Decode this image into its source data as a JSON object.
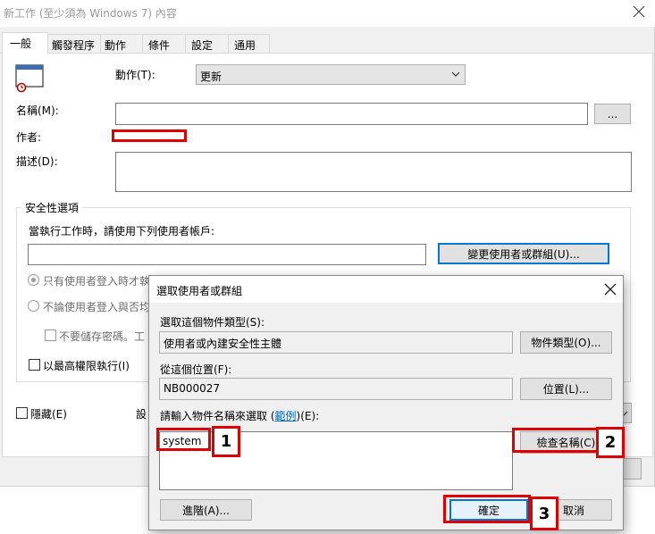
{
  "main_window": {
    "title": "新工作 (至少須為 Windows 7) 內容",
    "tabs": [
      {
        "label": "一般"
      },
      {
        "label": "觸發程序"
      },
      {
        "label": "動作"
      },
      {
        "label": "條件"
      },
      {
        "label": "設定"
      },
      {
        "label": "通用"
      }
    ],
    "action_label": "動作(T):",
    "action_value": "更新",
    "name_label": "名稱(M):",
    "name_value": "",
    "browse_label": "...",
    "author_label": "作者:",
    "description_label": "描述(D):",
    "security_legend": "安全性選項",
    "run_as_text": "當執行工作時，請使用下列使用者帳戶:",
    "change_user_button": "變更使用者或群組(U)...",
    "radio_logged_on": "只有使用者登入時才執",
    "radio_any": "不論使用者登入與否均",
    "no_store_password": "不要儲存密碼。工",
    "highest_privileges": "以最高權限執行(I)",
    "hidden_label": "隱藏(E)",
    "config_label": "設"
  },
  "dialog": {
    "title": "選取使用者或群組",
    "object_type_label": "選取這個物件類型(S):",
    "object_type_value": "使用者或內建安全性主體",
    "object_type_button": "物件類型(O)...",
    "location_label": "從這個位置(F):",
    "location_value": "NB000027",
    "location_button": "位置(L)...",
    "enter_label_pre": "請輸入物件名稱來選取 (",
    "enter_label_link": "範例",
    "enter_label_post": ")(E):",
    "object_name_value": "system",
    "check_names_button": "檢查名稱(C)",
    "advanced_button": "進階(A)...",
    "ok_button": "確定",
    "cancel_button": "取消"
  },
  "annotations": {
    "step1": "1",
    "step2": "2",
    "step3": "3"
  },
  "colors": {
    "highlight_red": "#e00000",
    "focus_blue": "#0078d7",
    "link_blue": "#0066cc"
  }
}
